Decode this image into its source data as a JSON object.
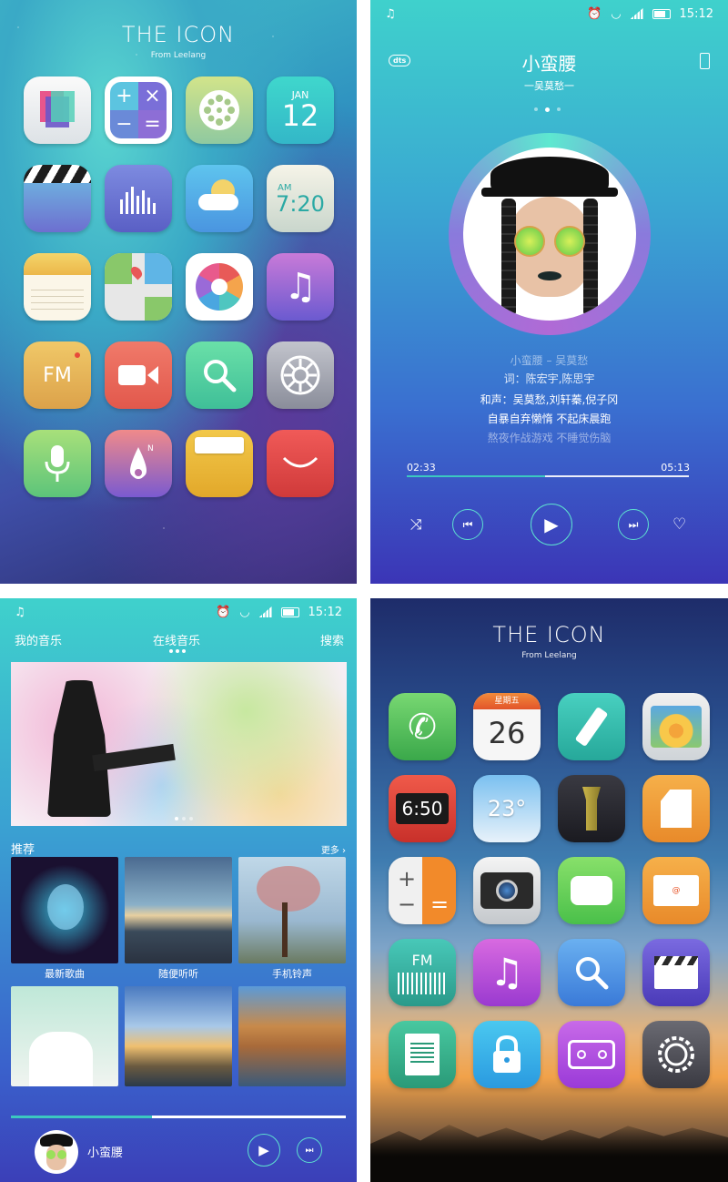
{
  "panel1": {
    "title": "THE  ICON",
    "subtitle": "From  Leelang",
    "calendar": {
      "month": "JAN",
      "day": "12"
    },
    "clock": {
      "ampm": "AM",
      "time": "7:20"
    },
    "fm_label": "FM",
    "icons": [
      "layers-icon",
      "calculator-icon",
      "film-reel-icon",
      "calendar-icon",
      "clapper-icon",
      "equalizer-icon",
      "weather-icon",
      "clock-icon",
      "notes-icon",
      "maps-icon",
      "camera-aperture-icon",
      "music-note-icon",
      "fm-radio-icon",
      "video-camera-icon",
      "search-icon",
      "settings-gear-icon",
      "microphone-icon",
      "compass-icon",
      "folder-icon",
      "store-bag-icon"
    ]
  },
  "panel2": {
    "status": {
      "time": "15:12"
    },
    "badge": "dts",
    "song_title": "小蛮腰",
    "artist_line": "一吴莫愁一",
    "lyrics": [
      "小蛮腰 – 吴莫愁",
      "词：陈宏宇,陈思宇",
      "和声：吴莫愁,刘轩蓁,倪子冈",
      "自暴自弃懒惰 不起床晨跑",
      "熬夜作战游戏 不睡觉伤脑"
    ],
    "time_elapsed": "02:33",
    "time_total": "05:13",
    "progress": 0.49
  },
  "panel3": {
    "status": {
      "time": "15:12"
    },
    "tabs": [
      "我的音乐",
      "在线音乐",
      "搜索"
    ],
    "section_title": "推荐",
    "more_label": "更多 ›",
    "albums": [
      "最新歌曲",
      "随便听听",
      "手机铃声"
    ],
    "now_playing": "小蛮腰",
    "progress": 0.42
  },
  "panel4": {
    "title": "THE  ICON",
    "subtitle": "From  Leelang",
    "calendar": {
      "weekday": "星期五",
      "day": "26"
    },
    "clock_time": "6:50",
    "weather_temp": "23°",
    "fm_label": "FM",
    "icons": [
      "phone-icon",
      "calendar-icon",
      "flashlight-icon",
      "photos-icon",
      "clock-icon",
      "weather-icon",
      "torch-icon",
      "sd-card-icon",
      "calculator-icon",
      "camera-icon",
      "messages-icon",
      "mail-icon",
      "fm-radio-icon",
      "music-note-icon",
      "search-icon",
      "video-clapper-icon",
      "notes-icon",
      "lock-icon",
      "tape-recorder-icon",
      "settings-gear-icon"
    ]
  }
}
